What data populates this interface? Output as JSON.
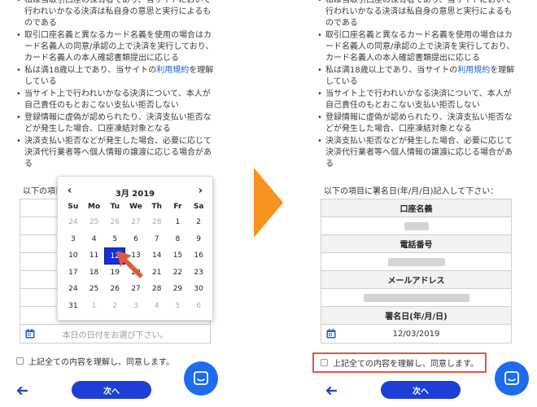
{
  "terms": [
    {
      "text": "私は当取引口座の保有者であり、当サイトにおいて行われいかなる決済は私自身の意思と実行によるものである"
    },
    {
      "text": "取引口座名義と異なるカード名義を使用の場合はカード名義人の同意/承認の上で決済を実行しており、カード名義人の本人確認書類提出に応じる"
    },
    {
      "text_before": "私は満18歳以上であり、当サイトの",
      "link": "利用規約",
      "text_after": "を理解している"
    },
    {
      "text": "当サイト上で行われいかなる決済について、本人が自己責任のもとおこない支払い拒否しない"
    },
    {
      "text": "登録情報に虚偽が認められたり、決済支払い拒否などが発生した場合、口座凍結対象となる"
    },
    {
      "text": "決済支払い拒否などが発生した場合、必要に応じて決済代行業者等へ個人情報の譲渡に応じる場合がある"
    }
  ],
  "left": {
    "prompt": "以下の項目に",
    "date_placeholder": "本日の日付をお選び下さい。",
    "agree_label": "上記全ての内容を理解し、同意します。",
    "next_label": "次へ"
  },
  "calendar": {
    "title": "3月 2019",
    "prev_icon": "chevron-left-icon",
    "next_icon": "chevron-right-icon",
    "weekdays": [
      "Su",
      "Mo",
      "Tu",
      "We",
      "Th",
      "Fr",
      "Sa"
    ],
    "days": [
      {
        "d": "24",
        "muted": true
      },
      {
        "d": "25",
        "muted": true
      },
      {
        "d": "26",
        "muted": true
      },
      {
        "d": "27",
        "muted": true
      },
      {
        "d": "28",
        "muted": true
      },
      {
        "d": "1"
      },
      {
        "d": "2"
      },
      {
        "d": "3"
      },
      {
        "d": "4"
      },
      {
        "d": "5"
      },
      {
        "d": "6"
      },
      {
        "d": "7"
      },
      {
        "d": "8"
      },
      {
        "d": "9"
      },
      {
        "d": "10"
      },
      {
        "d": "11"
      },
      {
        "d": "12",
        "selected": true
      },
      {
        "d": "13"
      },
      {
        "d": "14"
      },
      {
        "d": "15"
      },
      {
        "d": "16"
      },
      {
        "d": "17"
      },
      {
        "d": "18"
      },
      {
        "d": "19"
      },
      {
        "d": "20"
      },
      {
        "d": "21"
      },
      {
        "d": "22"
      },
      {
        "d": "23"
      },
      {
        "d": "24"
      },
      {
        "d": "25"
      },
      {
        "d": "26"
      },
      {
        "d": "27"
      },
      {
        "d": "28"
      },
      {
        "d": "29"
      },
      {
        "d": "30"
      },
      {
        "d": "31"
      },
      {
        "d": "1",
        "muted": true
      },
      {
        "d": "2",
        "muted": true
      },
      {
        "d": "3",
        "muted": true
      },
      {
        "d": "4",
        "muted": true
      },
      {
        "d": "5",
        "muted": true
      },
      {
        "d": "6",
        "muted": true
      }
    ]
  },
  "right": {
    "prompt": "以下の項目に署名日(年/月/日)記入して下さい：",
    "account_name_label": "口座名義",
    "phone_label": "電話番号",
    "email_label": "メールアドレス",
    "signature_date_label": "署名日(年/月/日)",
    "signature_date_value": "12/03/2019",
    "agree_label": "上記全ての内容を理解し、同意します。",
    "next_label": "次へ"
  },
  "colors": {
    "accent": "#1e3fd6",
    "link": "#1a62d8",
    "highlight": "#e05a3a",
    "arrow": "#f7931e",
    "chat": "#1c6cf0"
  }
}
